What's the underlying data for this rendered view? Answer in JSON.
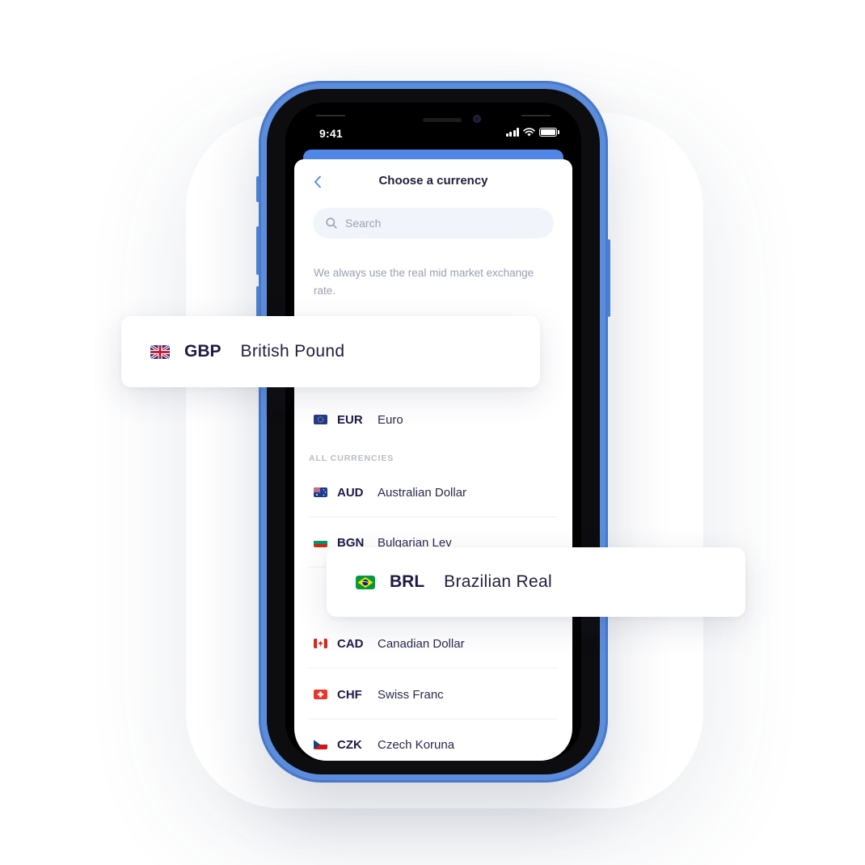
{
  "status_bar": {
    "time": "9:41"
  },
  "screen": {
    "title": "Choose a currency",
    "search": {
      "placeholder": "Search"
    },
    "note": "We always use the real mid market exchange rate.",
    "section_label": "ALL CURRENCIES",
    "popular": [
      {
        "code": "EUR",
        "name": "Euro",
        "flag": "eu-flag"
      }
    ],
    "currencies": [
      {
        "code": "AUD",
        "name": "Australian Dollar",
        "flag": "australia-flag"
      },
      {
        "code": "BGN",
        "name": "Bulgarian Lev",
        "flag": "bulgaria-flag"
      },
      {
        "code": "CAD",
        "name": "Canadian Dollar",
        "flag": "canada-flag"
      },
      {
        "code": "CHF",
        "name": "Swiss Franc",
        "flag": "switzerland-flag"
      },
      {
        "code": "CZK",
        "name": "Czech Koruna",
        "flag": "czech-flag"
      }
    ]
  },
  "floating_cards": [
    {
      "code": "GBP",
      "name": "British Pound",
      "flag": "uk-flag"
    },
    {
      "code": "BRL",
      "name": "Brazilian Real",
      "flag": "brazil-flag"
    }
  ],
  "colors": {
    "accent": "#4f86e8",
    "phone_frame": "#5b8ddc",
    "text_dark": "#1b1b45",
    "muted": "#9aa0b3"
  }
}
